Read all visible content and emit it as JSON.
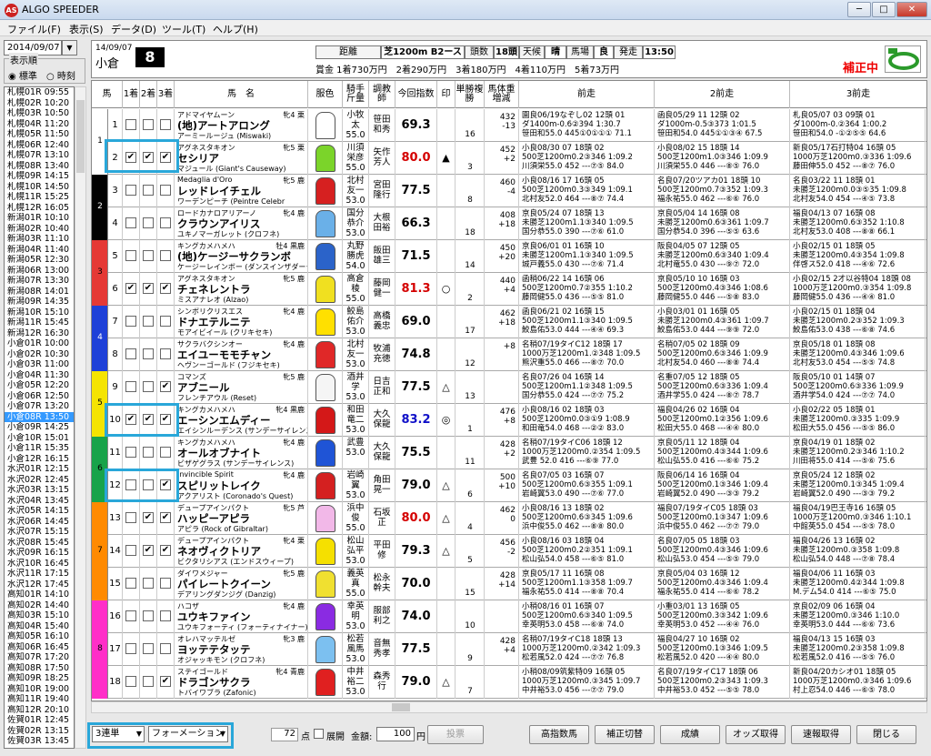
{
  "window": {
    "title": "ALGO SPEEDER",
    "icon_text": "AS",
    "min": "─",
    "max": "□",
    "close": "✕"
  },
  "menu": [
    {
      "label": "ファイル(F)"
    },
    {
      "label": "表示(S)"
    },
    {
      "label": "データ(D)"
    },
    {
      "label": "ツール(T)"
    },
    {
      "label": "ヘルプ(H)"
    }
  ],
  "left": {
    "date": "2014/09/07",
    "sort_label": "表示順",
    "sort_standard": "標準",
    "sort_time": "時刻",
    "races": [
      "札幌01R 09:55",
      "札幌02R 10:20",
      "札幌03R 10:50",
      "札幌04R 11:20",
      "札幌05R 11:50",
      "札幌06R 12:40",
      "札幌07R 13:10",
      "札幌08R 13:40",
      "札幌09R 14:15",
      "札幌10R 14:50",
      "札幌11R 15:25",
      "札幌12R 16:05",
      "新潟01R 10:10",
      "新潟02R 10:40",
      "新潟03R 11:10",
      "新潟04R 11:40",
      "新潟05R 12:30",
      "新潟06R 13:00",
      "新潟07R 13:30",
      "新潟08R 14:01",
      "新潟09R 14:35",
      "新潟10R 15:10",
      "新潟11R 15:45",
      "新潟12R 16:30",
      "小倉01R 10:00",
      "小倉02R 10:30",
      "小倉03R 11:00",
      "小倉04R 11:30",
      "小倉05R 12:20",
      "小倉06R 12:50",
      "小倉07R 13:20",
      "小倉08R 13:50",
      "小倉09R 14:25",
      "小倉10R 15:01",
      "小倉11R 15:35",
      "小倉12R 16:15",
      "水沢01R 12:15",
      "水沢02R 12:45",
      "水沢03R 13:15",
      "水沢04R 13:45",
      "水沢05R 14:15",
      "水沢06R 14:45",
      "水沢07R 15:15",
      "水沢08R 15:45",
      "水沢09R 16:15",
      "水沢10R 16:45",
      "水沢11R 17:15",
      "水沢12R 17:45",
      "高知01R 14:10",
      "高知02R 14:40",
      "高知03R 15:10",
      "高知04R 15:40",
      "高知05R 16:10",
      "高知06R 16:45",
      "高知07R 17:20",
      "高知08R 17:50",
      "高知09R 18:25",
      "高知10R 19:00",
      "高知11R 19:40",
      "高知12R 20:10",
      "佐賀01R 12:45",
      "佐賀02R 13:15",
      "佐賀03R 13:45"
    ],
    "selected_index": 31
  },
  "header": {
    "date": "14/09/07",
    "venue": "小倉",
    "race_no": "8",
    "distance_label": "距離",
    "distance": "芝1200m B2ース",
    "count_label": "頭数",
    "count": "18頭",
    "weather_label": "天候",
    "weather": "晴",
    "track_label": "馬場",
    "track": "良",
    "start_label": "発走",
    "start": "13:50",
    "prize": "賞金 1着730万円　2着290万円　3着180万円　4着110万円　5着73万円",
    "status": "補正中"
  },
  "columns": [
    "馬",
    "1着",
    "2着",
    "3着",
    "馬　名",
    "服色",
    "騎手斤量",
    "調教師",
    "今回指数",
    "印",
    "単勝複勝",
    "馬体重増減",
    "前走",
    "2前走",
    "3前走"
  ],
  "frame_colors": [
    "#ffffff",
    "#000000",
    "#e53935",
    "#1e40d8",
    "#f5e400",
    "#18a34a",
    "#ff8a00",
    "#ff2ec8"
  ],
  "horses": [
    {
      "no": "1",
      "frame": 1,
      "c1": "",
      "c2": "",
      "c3": "",
      "sire": "アドマイヤムーン",
      "sex": "牝4 栗",
      "name": "(地)アートアロング",
      "dam": "アーミールージュ (Miswaki)",
      "silk": "#ffffff",
      "jockey": "小牧太",
      "kin": "55.0",
      "trainer": "笹田和秀",
      "idx": "69.3",
      "idxcol": "#000",
      "mark": "",
      "fav": "16",
      "wt1": "432",
      "wt2": "-13",
      "p1a": "園良06/19なぞし02 12頭 01",
      "p1b": "ダ1400m-0.6②394 1:30.7",
      "p1c": "笹田和55.0 445①0①①①  71.1",
      "p2a": "函良05/29 11 12頭 02",
      "p2b": "ダ1000m-0.5③373 1:01.5",
      "p2c": "笹田和54.0 445①①③④  67.5",
      "p3a": "札良05/07 03 09頭 01",
      "p3b": "ダ1000m-0.②364 1:00.2",
      "p3c": "笹田和54.0 -①②⑤⑤  64.6"
    },
    {
      "no": "2",
      "frame": 1,
      "c1": "✔",
      "c2": "✔",
      "c3": "✔",
      "sire": "アグネスタキオン",
      "sex": "牝5 栗",
      "name": "セシリア",
      "dam": "マジュール (Giant's Causeway)",
      "silk": "#7bd42a",
      "jockey": "川須栄彦",
      "kin": "55.0",
      "trainer": "矢作芳人",
      "idx": "80.0",
      "idxcol": "#d40000",
      "mark": "▲",
      "fav": "3",
      "wt1": "452",
      "wt2": "+2",
      "p1a": "小良08/30 07 18頭 02",
      "p1b": "500芝1200m0.2③346 1:09.2",
      "p1c": "川須栄55.0 452 ---⑦⑤  84.0",
      "p2a": "小良08/02 15 18頭 14",
      "p2b": "500芝1200m1.0③346 1:09.9",
      "p2c": "川須栄55.0 446 ---⑧⑤  76.0",
      "p3a": "新良05/17石打特04 16頭 05",
      "p3b": "1000万芝1200m0.③336 1:09.6",
      "p3c": "藤田伸55.0 452 ---⑧⑦  76.0"
    },
    {
      "no": "3",
      "frame": 2,
      "c1": "",
      "c2": "",
      "c3": "",
      "sire": "Medaglia d'Oro",
      "sex": "牝5 鹿",
      "name": "レッドレイチェル",
      "dam": "ワーデンピーチ (Peintre Celebr",
      "silk": "#d62020",
      "jockey": "北村友一",
      "kin": "53.0",
      "trainer": "宮田隆行",
      "idx": "77.5",
      "idxcol": "#000",
      "mark": "",
      "fav": "8",
      "wt1": "460",
      "wt2": "-4",
      "p1a": "小良08/16 17 16頭 05",
      "p1b": "500芝1200m0.3③349 1:09.1",
      "p1c": "北村友52.0 464 ---⑧⑦  74.4",
      "p2a": "名良07/20ツアカ01 18頭 10",
      "p2b": "500芝1200m0.7③352 1:09.3",
      "p2c": "福永祐55.0 462 ---⑥⑥  76.0",
      "p3a": "名良03/22 11 18頭 01",
      "p3b": "未勝芝1200m0.0③⑤35 1:09.8",
      "p3c": "北村友54.0 454 ---④⑤  73.8"
    },
    {
      "no": "4",
      "frame": 2,
      "c1": "",
      "c2": "",
      "c3": "",
      "sire": "ロードカナロアリアーノ",
      "sex": "牝4 鹿",
      "name": "クラウンアイリス",
      "dam": "ユキノマーガレット (クロフネ)",
      "silk": "#6ab0e8",
      "jockey": "国分恭介",
      "kin": "53.0",
      "trainer": "大根田裕",
      "idx": "66.3",
      "idxcol": "#000",
      "mark": "",
      "fav": "18",
      "wt1": "408",
      "wt2": "+18",
      "p1a": "京良05/24 07 18頭 13",
      "p1b": "未勝芝1200m1.1③340 1:09.5",
      "p1c": "国分恭55.0 390 ---⑦⑥  61.0",
      "p2a": "京良05/04 14 16頭 08",
      "p2b": "未勝芝1200m0.6③361 1:09.7",
      "p2c": "国分恭54.0 396 ---⑤⑤  63.6",
      "p3a": "福良04/13 07 16頭 08",
      "p3b": "未勝芝1200m0.6③352 1:10.8",
      "p3c": "北村友53.0 408 ---⑧⑧  66.1"
    },
    {
      "no": "5",
      "frame": 3,
      "c1": "",
      "c2": "",
      "c3": "",
      "sire": "キングカメハメハ",
      "sex": "牡4 黒鹿",
      "name": "(地)ケージーサクランボ",
      "dam": "ケージーレインボー (ダンスインザダーク",
      "silk": "#2b63c9",
      "jockey": "丸野勝虎",
      "kin": "54.0",
      "trainer": "飯田雄三",
      "idx": "71.5",
      "idxcol": "#000",
      "mark": "",
      "fav": "14",
      "wt1": "450",
      "wt2": "+20",
      "p1a": "京良06/01 01 16頭 10",
      "p1b": "未勝芝1200m1.1③340 1:09.5",
      "p1c": "城戸義55.0 430 ---⑦⑥  71.4",
      "p2a": "阪良04/05 07 12頭 05",
      "p2b": "未勝芝1200m0.6③340 1:09.4",
      "p2c": "北村竜55.0 430 ---⑨⑦  72.0",
      "p3a": "小良02/15 01 18頭 05",
      "p3b": "未勝芝1200m0.4③354 1:09.8",
      "p3c": "伴啓ス52.0 418 ---④⑥  72.6"
    },
    {
      "no": "6",
      "frame": 3,
      "c1": "✔",
      "c2": "✔",
      "c3": "✔",
      "sire": "アグネスタキオン",
      "sex": "牝5 鹿",
      "name": "チェネレントラ",
      "dam": "ミスアナレオ (Alzao)",
      "silk": "#f0e020",
      "jockey": "高倉稜",
      "kin": "55.0",
      "trainer": "藤岡健一",
      "idx": "81.3",
      "idxcol": "#d40000",
      "mark": "○",
      "fav": "2",
      "wt1": "440",
      "wt2": "+4",
      "p1a": "函稍06/22 14 16頭 06",
      "p1b": "500芝1200m0.7②355 1:10.2",
      "p1c": "藤岡健55.0 436 ---⑤⑤  81.0",
      "p2a": "京良05/10 10 16頭 03",
      "p2b": "500芝1200m0.4③346 1:08.6",
      "p2c": "藤岡健55.0 446 ---⑤⑧  83.0",
      "p3a": "小良02/15 2才以谷特04 18頭 08",
      "p3b": "1000万芝1200m0.③354 1:09.8",
      "p3c": "藤岡健55.0 436 ---④④  81.0"
    },
    {
      "no": "7",
      "frame": 4,
      "c1": "",
      "c2": "",
      "c3": "",
      "sire": "シンボリクリスエス",
      "sex": "牝4 鹿",
      "name": "ドナエテルニテ",
      "dam": "モアイビイール (クリキセキ)",
      "silk": "#ffe000",
      "jockey": "鮫島佑介",
      "kin": "53.0",
      "trainer": "高橋義忠",
      "idx": "69.0",
      "idxcol": "#000",
      "mark": "",
      "fav": "17",
      "wt1": "462",
      "wt2": "+18",
      "p1a": "函良06/21 02 16頭 15",
      "p1b": "500芝1200m1.1③340 1:09.5",
      "p1c": "鮫島佑53.0 444 ---④④  69.3",
      "p2a": "小良03/01 01 16頭 05",
      "p2b": "未勝芝1200m0.4③361 1:09.7",
      "p2c": "鮫島佑53.0 444 ---⑨⑨  72.0",
      "p3a": "小良02/15 01 18頭 04",
      "p3b": "未勝芝1200m0.2③352 1:09.3",
      "p3c": "鮫島佑53.0 438 ---⑥⑧  74.6"
    },
    {
      "no": "8",
      "frame": 4,
      "c1": "",
      "c2": "",
      "c3": "",
      "sire": "サクラバクシンオー",
      "sex": "牝4 鹿",
      "name": "エイユーモモチャン",
      "dam": "ヘヴンーゴールド (フジキセキ)",
      "silk": "#e02828",
      "jockey": "北村友一",
      "kin": "53.0",
      "trainer": "牧浦充徳",
      "idx": "74.8",
      "idxcol": "#000",
      "mark": "",
      "fav": "12",
      "wt1": "",
      "wt2": "+8",
      "p1a": "名稍07/19タイC12 18頭 17",
      "p1b": "1000万芝1200m1.②348 1:09.5",
      "p1c": "熊沢重55.0 466 ---⑧⑦  70.0",
      "p2a": "名稍07/05 02 18頭 09",
      "p2b": "500芝1200m0.6③346 1:09.9",
      "p2c": "北村友54.0 460 ---⑧⑧  74.4",
      "p3a": "京良05/18 01 18頭 08",
      "p3b": "未勝芝1200m0.4③346 1:09.6",
      "p3c": "北村友53.0 454 ---⑤⑤  74.8"
    },
    {
      "no": "9",
      "frame": 5,
      "c1": "",
      "c2": "",
      "c3": "✔",
      "sire": "コマンズ",
      "sex": "牝5 鹿",
      "name": "アブニール",
      "dam": "フレンチアウル (Reset)",
      "silk": "#f5f5f5",
      "jockey": "酒井学",
      "kin": "53.0",
      "trainer": "日吉正和",
      "idx": "77.5",
      "idxcol": "#000",
      "mark": "△",
      "fav": "13",
      "wt1": "",
      "wt2": "",
      "p1a": "名良07/26 04 16頭 14",
      "p1b": "500芝1200m1.1②348 1:09.5",
      "p1c": "国分恭55.0 424 ---⑦⑦  75.2",
      "p2a": "名重07/05 12 18頭 05",
      "p2b": "500芝1200m0.6③336 1:09.4",
      "p2c": "酒井学55.0 424 ---⑧⑦  78.7",
      "p3a": "阪良05/10 01 14頭 07",
      "p3b": "500芝1200m0.6③336 1:09.9",
      "p3c": "酒井学54.0 424 ---⑦⑦  74.0"
    },
    {
      "no": "10",
      "frame": 5,
      "c1": "✔",
      "c2": "✔",
      "c3": "✔",
      "sire": "キングカメハメハ",
      "sex": "牝4 黒鹿",
      "name": "エーシンエムディー",
      "dam": "エイシンルーデンス (サンデーサイレンス)",
      "silk": "#d41818",
      "jockey": "和田竜二",
      "kin": "53.0",
      "trainer": "大久保龍",
      "idx": "83.2",
      "idxcol": "#1010c8",
      "mark": "◎",
      "fav": "1",
      "wt1": "476",
      "wt2": "+8",
      "p1a": "小良08/16 02 18頭 03",
      "p1b": "500芝1200m0.0③①9 1:08.9",
      "p1c": "和田竜54.0 468 ---②②  83.0",
      "p2a": "福良04/26 02 16頭 04",
      "p2b": "500芝1200m0.1②356 1:09.6",
      "p2c": "松田大55.0 468 ---④④  80.0",
      "p3a": "小良02/22 05 18頭 01",
      "p3b": "未勝芝1200m0.③335 1:09.9",
      "p3c": "松田大55.0 456 ---⑤⑤  86.0"
    },
    {
      "no": "11",
      "frame": 6,
      "c1": "",
      "c2": "",
      "c3": "",
      "sire": "キングカメハメハ",
      "sex": "牝4 鹿",
      "name": "オールオブナイト",
      "dam": "ビザゲグラス (サンデーサイレンス)",
      "silk": "#1f54d6",
      "jockey": "武豊",
      "kin": "53.0",
      "trainer": "大久保龍",
      "idx": "75.5",
      "idxcol": "#000",
      "mark": "",
      "fav": "11",
      "wt1": "428",
      "wt2": "+2",
      "p1a": "名稍07/19タイC06 18頭 12",
      "p1b": "1000万芝1200m0.②354 1:09.5",
      "p1c": "武豊  52.0 416 ---⑥⑨  77.0",
      "p2a": "京良05/11 12 18頭 04",
      "p2b": "500芝1200m0.4③344 1:09.6",
      "p2c": "松山弘55.0 416 ---⑥⑥  75.2",
      "p3a": "京良04/19 01 18頭 02",
      "p3b": "未勝芝1200m0.2③346 1:10.2",
      "p3c": "川田将55.0 414 ---⑤⑥  75.6"
    },
    {
      "no": "12",
      "frame": 6,
      "c1": "",
      "c2": "",
      "c3": "✔",
      "sire": "Invincible Spirit",
      "sex": "牝4 鹿",
      "name": "スピリットレイク",
      "dam": "アクアリスト (Coronado's Quest)",
      "silk": "#d42020",
      "jockey": "岩崎翼",
      "kin": "53.0",
      "trainer": "角田晃一",
      "idx": "79.0",
      "idxcol": "#000",
      "mark": "△",
      "fav": "6",
      "wt1": "500",
      "wt2": "+10",
      "p1a": "名良07/05 03 16頭 07",
      "p1b": "500芝1200m0.6③355 1:09.1",
      "p1c": "岩崎翼53.0 490 ---⑦⑥  77.0",
      "p2a": "阪良06/14 16 16頭 04",
      "p2b": "500芝1200m0.1③346 1:09.4",
      "p2c": "岩崎翼52.0 490 ---③③  79.2",
      "p3a": "京良05/24 12 18頭 02",
      "p3b": "未勝芝1200m0.1③345 1:09.4",
      "p3c": "岩崎翼52.0 490 ---③③  79.2"
    },
    {
      "no": "13",
      "frame": 7,
      "c1": "",
      "c2": "✔",
      "c3": "✔",
      "sire": "デュープアインパクト",
      "sex": "牝5 芦",
      "name": "ハッピーアピラ",
      "dam": "アピラ (Rock of Gibraltar)",
      "silk": "#f2b8e8",
      "jockey": "浜中俊",
      "kin": "55.0",
      "trainer": "石坂正",
      "idx": "80.0",
      "idxcol": "#d40000",
      "mark": "△",
      "fav": "4",
      "wt1": "462",
      "wt2": "0",
      "p1a": "小良08/16 13 18頭 02",
      "p1b": "500芝1200m0.6③345 1:09.6",
      "p1c": "浜中俊55.0 462 ---⑧⑧  80.0",
      "p2a": "福良07/19タイC05 18頭 03",
      "p2b": "500芝1200m0.1③347 1:09.6",
      "p2c": "浜中俊55.0 462 ---⑦⑦  79.0",
      "p3a": "福良04/19巴王寺16 16頭 05",
      "p3b": "1000万芝1200m0.③346 1:10.1",
      "p3c": "中館英55.0 454 ---⑤⑤  78.0"
    },
    {
      "no": "14",
      "frame": 7,
      "c1": "",
      "c2": "✔",
      "c3": "✔",
      "sire": "デュープアインパクト",
      "sex": "牝4 栗",
      "name": "ネオヴィクトリア",
      "dam": "ビクタリシアス (エンドスウィープ)",
      "silk": "#f5e000",
      "jockey": "松山弘平",
      "kin": "53.0",
      "trainer": "平田修",
      "idx": "79.3",
      "idxcol": "#000",
      "mark": "△",
      "fav": "5",
      "wt1": "456",
      "wt2": "-2",
      "p1a": "小良08/16 03 18頭 04",
      "p1b": "500芝1200m0.2②351 1:09.1",
      "p1c": "松山弘54.0 458 ---⑥⑤  81.0",
      "p2a": "名良07/05 05 18頭 03",
      "p2b": "500芝1200m0.4③346 1:09.6",
      "p2c": "松山弘53.0 454 ---⑤⑤  79.0",
      "p3a": "福良04/26 13 16頭 02",
      "p3b": "未勝芝1200m0.③358 1:09.8",
      "p3c": "松山弘54.0 448 ---⑦⑧  78.4"
    },
    {
      "no": "15",
      "frame": 7,
      "c1": "",
      "c2": "",
      "c3": "",
      "sire": "ダイワメジャー",
      "sex": "牝5 鹿",
      "name": "パイレートクイーン",
      "dam": "デアリングダンジグ (Danzig)",
      "silk": "#f0e030",
      "jockey": "義英真",
      "kin": "55.0",
      "trainer": "松永幹夫",
      "idx": "70.0",
      "idxcol": "#000",
      "mark": "",
      "fav": "15",
      "wt1": "428",
      "wt2": "+14",
      "p1a": "京良05/17 11 16頭 08",
      "p1b": "500芝1200m1.1③358 1:09.7",
      "p1c": "福永祐55.0 414 ---⑧⑧  70.4",
      "p2a": "京良05/04 03 16頭 12",
      "p2b": "500芝1200m0.4③346 1:09.4",
      "p2c": "福永祐55.0 414 ---⑥⑥  78.2",
      "p3a": "福良04/06 11 16頭 03",
      "p3b": "未勝芝1200m0.4②344 1:09.8",
      "p3c": "M.デム54.0 414 ---⑥⑤  75.0"
    },
    {
      "no": "16",
      "frame": 8,
      "c1": "",
      "c2": "",
      "c3": "",
      "sire": "ハコザ",
      "sex": "牝4 鹿",
      "name": "ユウキファイン",
      "dam": "ユウキフォーティ (フォーティナイナー)",
      "silk": "#8a2be2",
      "jockey": "幸英明",
      "kin": "53.0",
      "trainer": "服部利之",
      "idx": "74.0",
      "idxcol": "#000",
      "mark": "",
      "fav": "10",
      "wt1": "",
      "wt2": "",
      "p1a": "小稍08/16 01 16頭 07",
      "p1b": "500芝1200m0.6③340 1:09.5",
      "p1c": "幸英明53.0 458 ---⑥⑧  74.0",
      "p2a": "小重03/01 13 16頭 05",
      "p2b": "500芝1200m0.3③342 1:09.6",
      "p2c": "幸英明53.0 452 ---④④  76.0",
      "p3a": "京良02/09 06 16頭 04",
      "p3b": "未勝芝1200m0.③346 1:10.0",
      "p3c": "幸英明53.0 444 ---⑥⑥  73.6"
    },
    {
      "no": "17",
      "frame": 8,
      "c1": "",
      "c2": "",
      "c3": "",
      "sire": "オレハマッテルゼ",
      "sex": "牝3 鹿",
      "name": "ヨッテテタッテ",
      "dam": "オジャッキモン (クロフネ)",
      "silk": "#7cc0f0",
      "jockey": "松若風馬",
      "kin": "53.0",
      "trainer": "音無秀孝",
      "idx": "77.5",
      "idxcol": "#000",
      "mark": "",
      "fav": "9",
      "wt1": "428",
      "wt2": "+4",
      "p1a": "名稍07/19タイC18 18頭 13",
      "p1b": "1000万芝1200m0.②342 1:09.3",
      "p1c": "松若風52.0 424 ---⑦⑦  76.8",
      "p2a": "福良04/27 10 16頭 02",
      "p2b": "500芝1200m0.1③346 1:09.5",
      "p2c": "松若風52.0 420 ---④④  80.0",
      "p3a": "福良04/13 15 16頭 03",
      "p3b": "未勝芝1200m0.2③358 1:09.8",
      "p3c": "松若風52.0 416 ---⑤⑤  76.0"
    },
    {
      "no": "18",
      "frame": 8,
      "c1": "",
      "c2": "",
      "c3": "✔",
      "sire": "ステイゴールド",
      "sex": "牝4 青鹿",
      "name": "ドラゴンサクラ",
      "dam": "トバイワブラ (Zafonic)",
      "silk": "#e02020",
      "jockey": "中井裕二",
      "kin": "53.0",
      "trainer": "森秀行",
      "idx": "79.0",
      "idxcol": "#000",
      "mark": "△",
      "fav": "7",
      "wt1": "",
      "wt2": "",
      "p1a": "小稍08/09筑紫特09 16頭 05",
      "p1b": "1000万芝1200m0.③345 1:09.7",
      "p1c": "中井裕53.0 456 ---⑦⑦  79.0",
      "p2a": "名良07/19タイC17 18頭 06",
      "p2b": "500芝1200m0.2③343 1:09.3",
      "p2c": "中井裕53.0 452 ---⑤⑤  78.0",
      "p3a": "新良04/20カシオ01 18頭 05",
      "p3b": "1000万芝1200m0.③346 1:09.6",
      "p3c": "村上忍54.0 446 ---⑥⑤  78.0"
    }
  ],
  "footer": {
    "bet_type": "3連単",
    "bet_method": "フォーメーション",
    "points_label": "点",
    "points": "72",
    "expand_label": "展開",
    "amount_label": "金額:",
    "amount": "100",
    "amount_unit": "円",
    "vote": "投票",
    "buttons": [
      "高指数馬",
      "補正切替",
      "成績",
      "オッズ取得",
      "速報取得",
      "閉じる"
    ]
  }
}
